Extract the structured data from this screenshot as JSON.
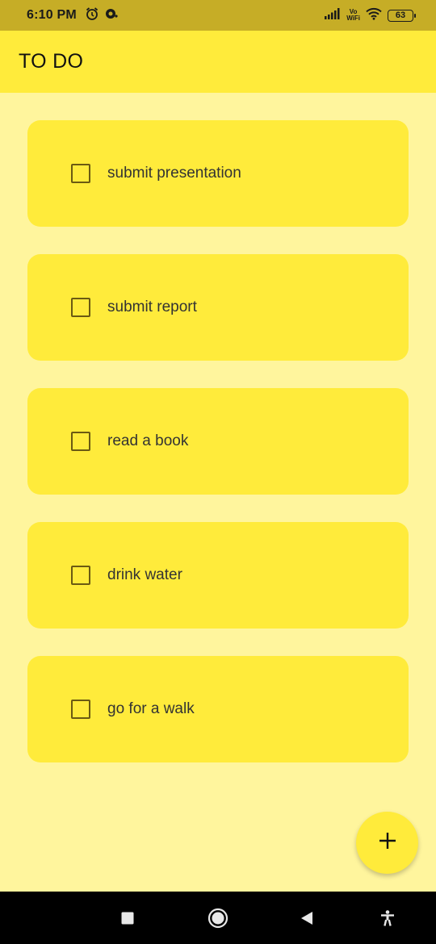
{
  "status_bar": {
    "time": "6:10 PM",
    "network_label_top": "Vo",
    "network_label_bottom": "WiFi",
    "battery": "63",
    "icons": [
      "alarm-icon",
      "notification-icon",
      "signal-icon",
      "wifi-icon",
      "battery-icon"
    ]
  },
  "app_bar": {
    "title": "TO DO"
  },
  "tasks": [
    {
      "label": "submit presentation",
      "checked": false
    },
    {
      "label": "submit report",
      "checked": false
    },
    {
      "label": "read a book",
      "checked": false
    },
    {
      "label": "drink water",
      "checked": false
    },
    {
      "label": "go for a walk",
      "checked": false
    }
  ],
  "fab": {
    "icon": "plus-icon"
  },
  "nav_bar": {
    "icons": [
      "recents-icon",
      "home-icon",
      "back-icon",
      "accessibility-icon"
    ]
  },
  "colors": {
    "status_bar": "#c6ad26",
    "app_bar": "#ffeb3b",
    "background": "#fff59d",
    "card": "#ffeb3b",
    "checkbox_border": "#6b5a12"
  }
}
